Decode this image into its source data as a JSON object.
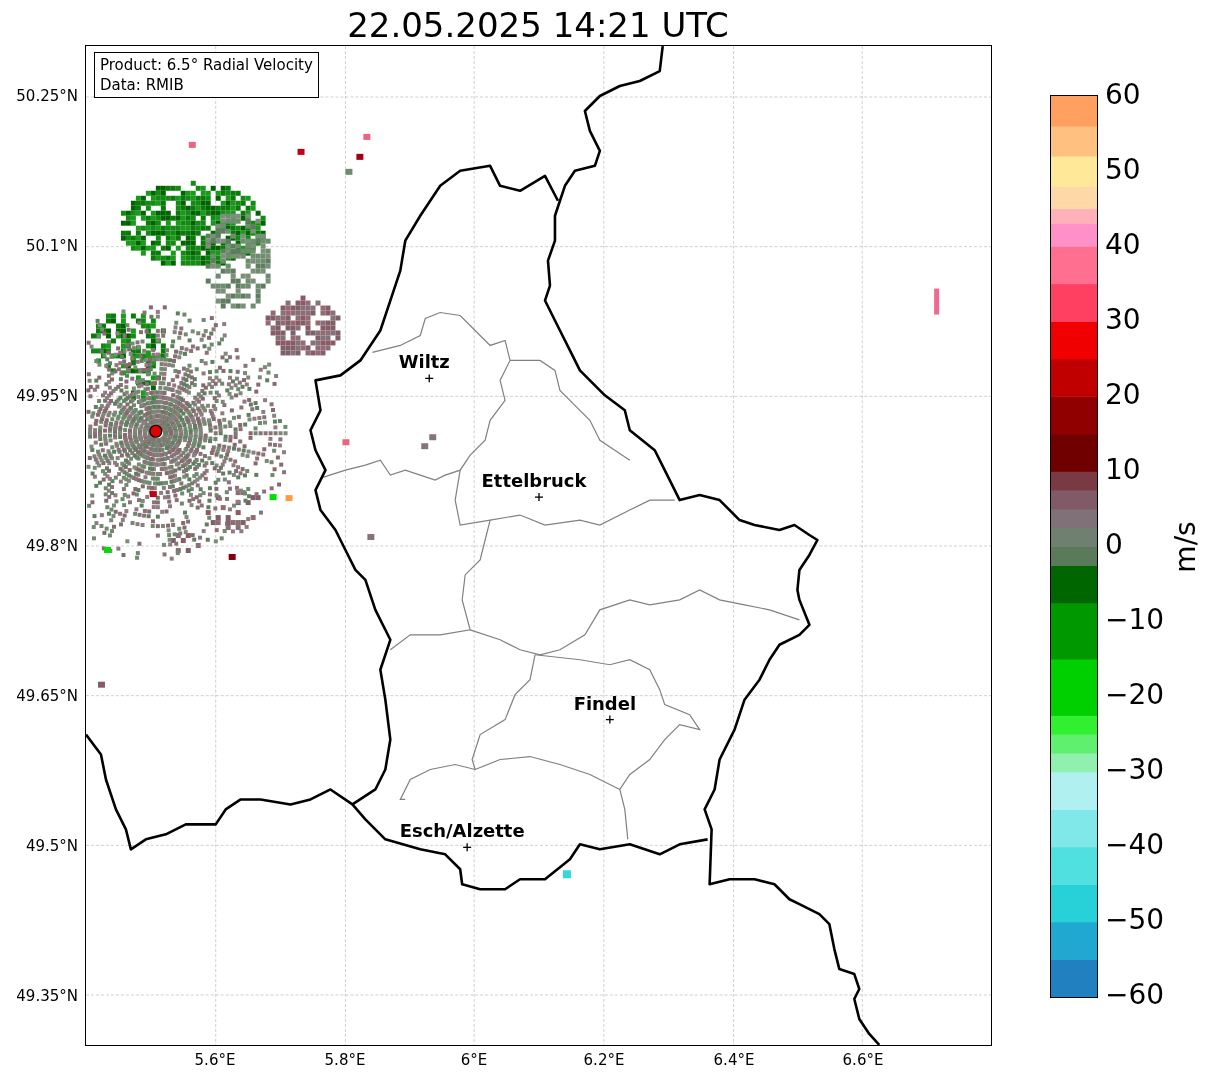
{
  "title": "22.05.2025 14:21 UTC",
  "info_box": {
    "lines": [
      "Product: 6.5° Radial Velocity",
      "Data: RMIB"
    ]
  },
  "map": {
    "lat_ticks": [
      "50.25°N",
      "50.1°N",
      "49.95°N",
      "49.8°N",
      "49.65°N",
      "49.5°N",
      "49.35°N"
    ],
    "lon_ticks": [
      "5.6°E",
      "5.8°E",
      "6°E",
      "6.2°E",
      "6.4°E",
      "6.6°E"
    ],
    "cities": [
      {
        "name": "Wiltz"
      },
      {
        "name": "Ettelbruck"
      },
      {
        "name": "Findel"
      },
      {
        "name": "Esch/Alzette"
      }
    ]
  },
  "colorbar": {
    "label": "m/s",
    "ticks": [
      "60",
      "50",
      "40",
      "30",
      "20",
      "10",
      "0",
      "−10",
      "−20",
      "−30",
      "−40",
      "−50",
      "−60"
    ]
  }
}
